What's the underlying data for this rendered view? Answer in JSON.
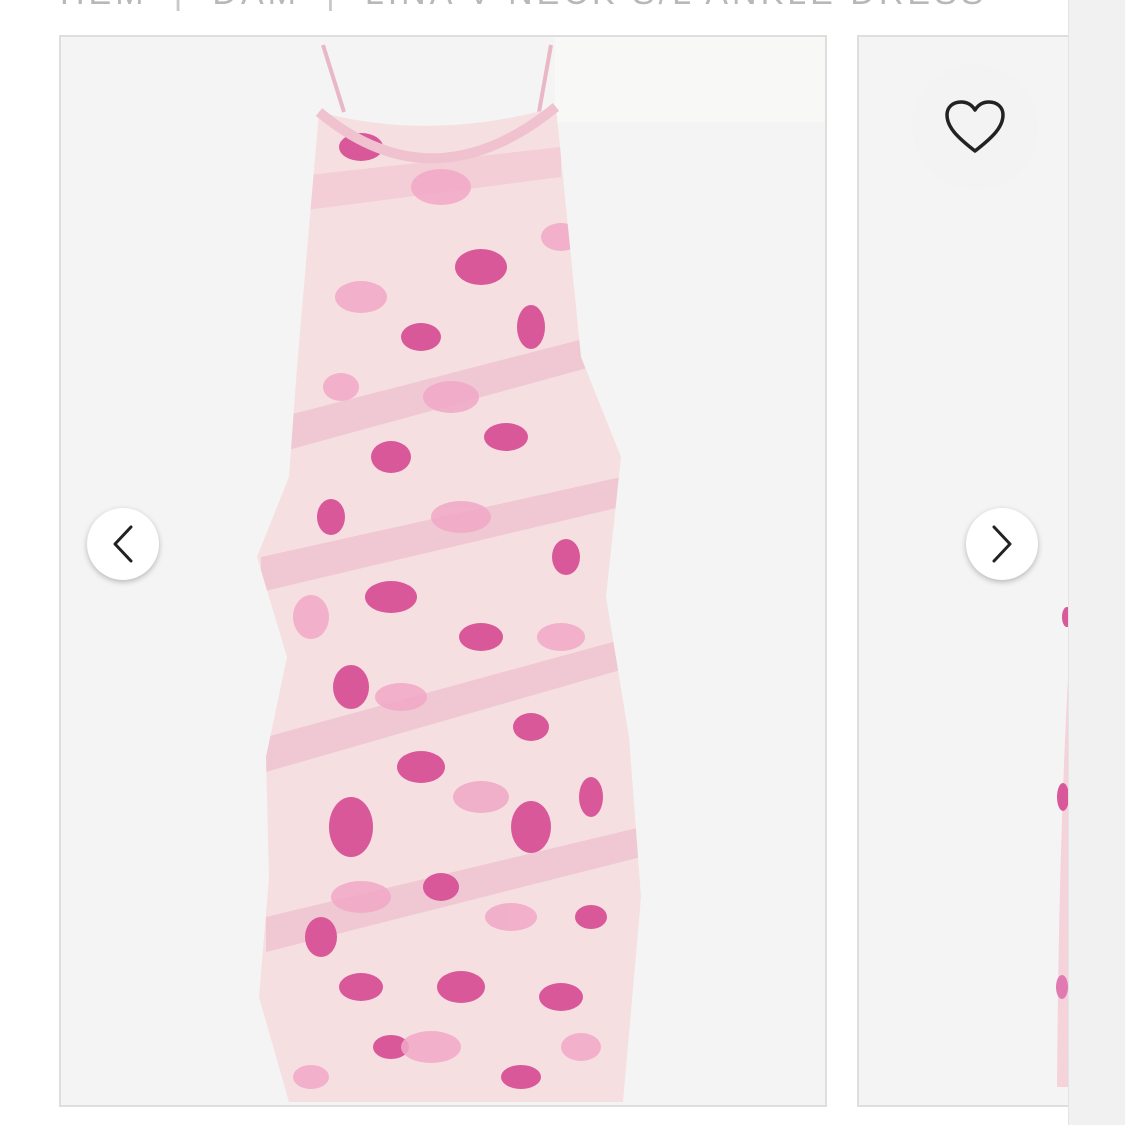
{
  "breadcrumb": {
    "items": [
      {
        "label": "HEM"
      },
      {
        "label": "DAM"
      },
      {
        "label": "LINA V-NECK S/L ANKLE DRESS"
      }
    ],
    "separator": "|"
  },
  "gallery": {
    "prev_icon": "chevron-left-icon",
    "next_icon": "chevron-right-icon",
    "wishlist_icon": "heart-outline-icon"
  },
  "colors": {
    "dress_base": "#f6dfe1",
    "print_dark": "#d9589a",
    "print_light": "#f1a8c6",
    "background": "#f4f4f4"
  }
}
